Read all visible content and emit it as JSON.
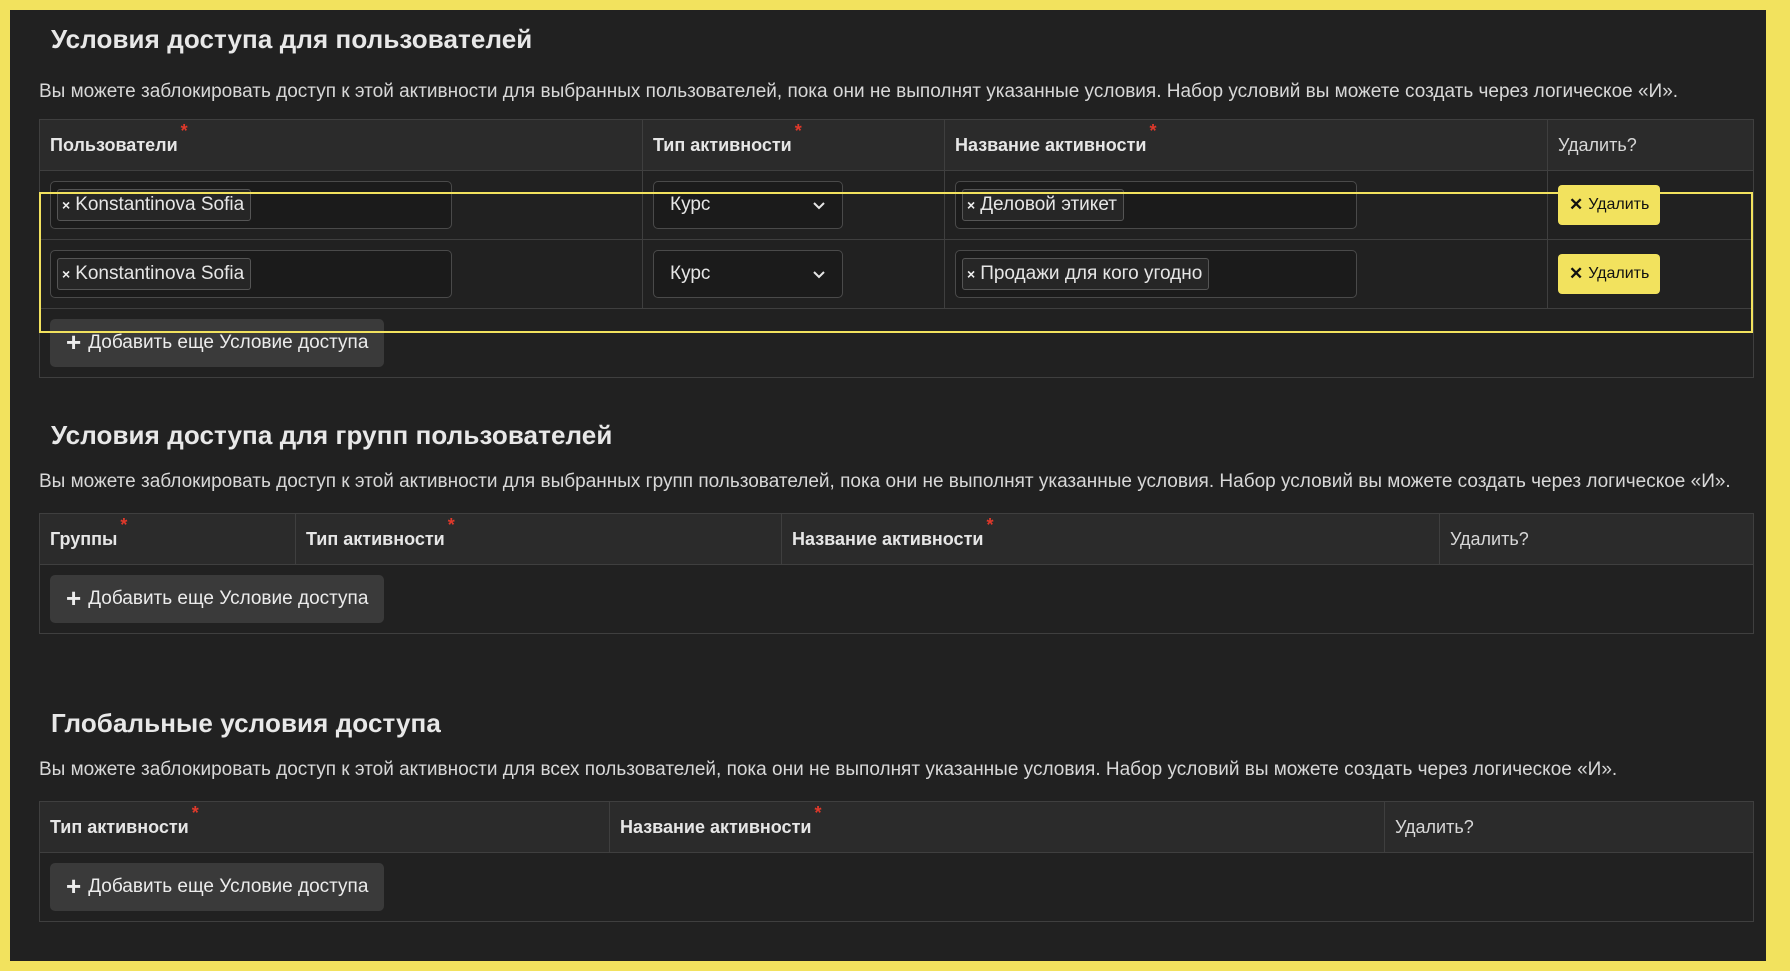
{
  "colors": {
    "accent": "#f2e25e",
    "panel": "#212121",
    "required": "#e0392b"
  },
  "icons": {
    "remove_tag": "x-icon",
    "delete": "x-icon",
    "add": "plus-icon",
    "dropdown": "chevron-down-icon"
  },
  "users_section": {
    "title": "Условия доступа для пользователей",
    "description": "Вы можете заблокировать доступ к этой активности для выбранных пользователей, пока они не выполнят указанные условия. Набор условий вы можете создать через логическое «И».",
    "columns": {
      "users": "Пользователи",
      "type": "Тип активности",
      "name": "Название активности",
      "delete": "Удалить?"
    },
    "rows": [
      {
        "user": "Konstantinova Sofia",
        "type": "Курс",
        "activity": "Деловой этикет",
        "delete_label": "Удалить"
      },
      {
        "user": "Konstantinova Sofia",
        "type": "Курс",
        "activity": "Продажи для кого угодно",
        "delete_label": "Удалить"
      }
    ],
    "add_label": "Добавить еще Условие доступа"
  },
  "groups_section": {
    "title": "Условия доступа для групп пользователей",
    "description": "Вы можете заблокировать доступ к этой активности для выбранных групп пользователей, пока они не выполнят указанные условия. Набор условий вы можете создать через логическое «И».",
    "columns": {
      "groups": "Группы",
      "type": "Тип активности",
      "name": "Название активности",
      "delete": "Удалить?"
    },
    "add_label": "Добавить еще Условие доступа"
  },
  "global_section": {
    "title": "Глобальные условия доступа",
    "description": "Вы можете заблокировать доступ к этой активности для всех пользователей, пока они не выполнят указанные условия. Набор условий вы можете создать через логическое «И».",
    "columns": {
      "type": "Тип активности",
      "name": "Название активности",
      "delete": "Удалить?"
    },
    "add_label": "Добавить еще Условие доступа"
  },
  "required_mark": "*",
  "tag_remove_glyph": "×",
  "delete_glyph": "✕",
  "add_glyph": "+"
}
